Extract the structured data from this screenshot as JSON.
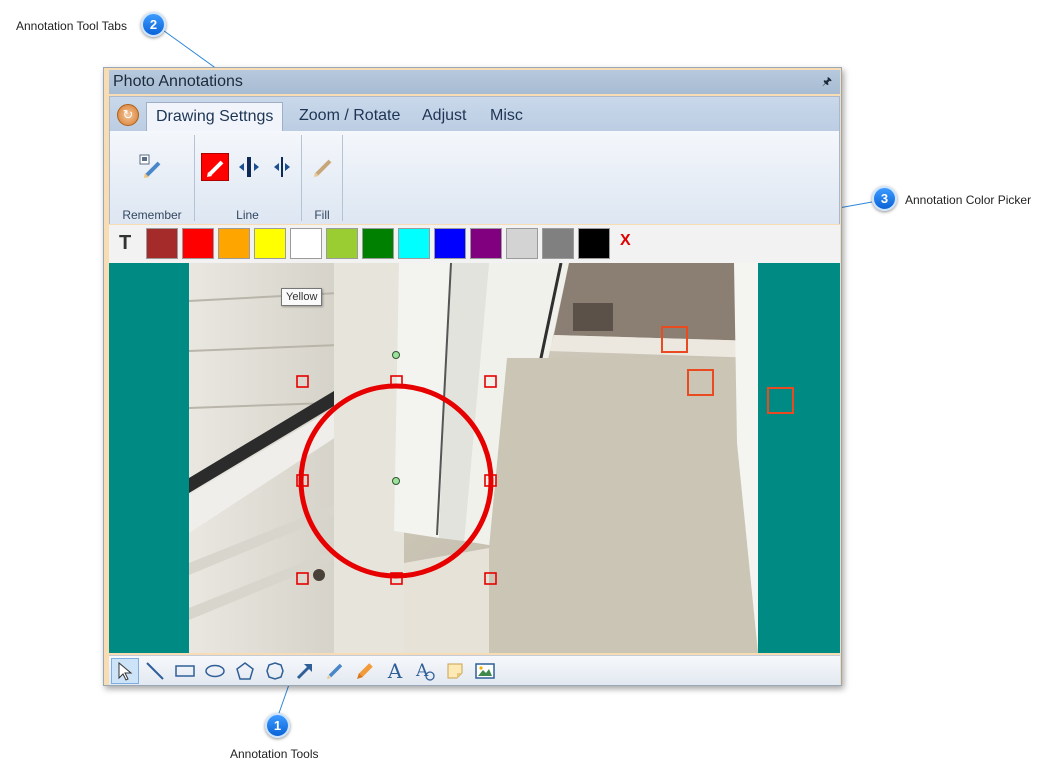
{
  "callouts": [
    {
      "number": "1",
      "label": "Annotation Tools"
    },
    {
      "number": "2",
      "label": "Annotation Tool Tabs"
    },
    {
      "number": "3",
      "label": "Annotation Color Picker"
    }
  ],
  "window": {
    "title": "Photo Annotations",
    "pin_icon": "pin-icon"
  },
  "ribbon": {
    "app_button_icon": "refresh-icon",
    "tabs": [
      {
        "label": "Drawing Settngs",
        "active": true
      },
      {
        "label": "Zoom / Rotate",
        "active": false
      },
      {
        "label": "Adjust",
        "active": false
      },
      {
        "label": "Misc",
        "active": false
      }
    ],
    "groups": [
      {
        "label": "Remember",
        "icons": [
          "remember-pen-icon"
        ]
      },
      {
        "label": "Line",
        "icons": [
          "line-color-pen-icon",
          "line-thick-icon",
          "line-thin-icon"
        ]
      },
      {
        "label": "Fill",
        "icons": [
          "fill-pen-icon"
        ]
      }
    ]
  },
  "colors": {
    "text_tool": "T",
    "swatches": [
      {
        "name": "brown",
        "hex": "#a52a2a"
      },
      {
        "name": "red",
        "hex": "#ff0000"
      },
      {
        "name": "orange",
        "hex": "#ffa500"
      },
      {
        "name": "yellow",
        "hex": "#ffff00"
      },
      {
        "name": "white",
        "hex": "#ffffff"
      },
      {
        "name": "yellowgreen",
        "hex": "#9acd32"
      },
      {
        "name": "green",
        "hex": "#008000"
      },
      {
        "name": "cyan",
        "hex": "#00ffff"
      },
      {
        "name": "blue",
        "hex": "#0000ff"
      },
      {
        "name": "purple",
        "hex": "#800080"
      },
      {
        "name": "lightgray",
        "hex": "#d3d3d3"
      },
      {
        "name": "gray",
        "hex": "#808080"
      },
      {
        "name": "black",
        "hex": "#000000"
      }
    ],
    "clear_label": "X",
    "tooltip": "Yellow"
  },
  "canvas": {
    "background": "#008a84",
    "annotation_color": "#e60000"
  },
  "tools": [
    "select-arrow-icon",
    "line-icon",
    "rectangle-icon",
    "ellipse-icon",
    "pentagon-icon",
    "circle-icon",
    "arrow-icon",
    "pencil-icon",
    "highlighter-icon",
    "text-icon",
    "callout-text-icon",
    "note-icon",
    "image-icon"
  ]
}
